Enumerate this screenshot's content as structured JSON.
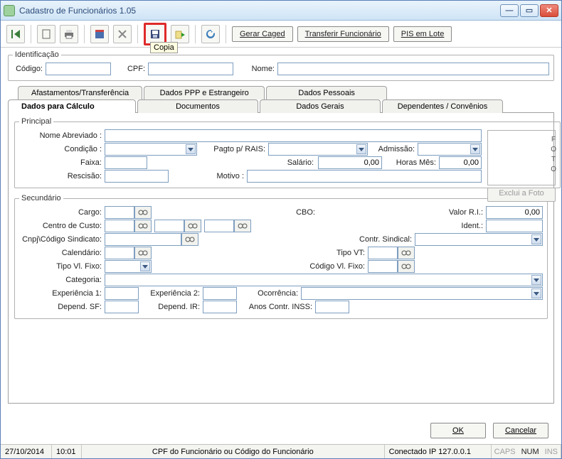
{
  "window": {
    "title": "Cadastro de Funcionários 1.05"
  },
  "toolbar": {
    "tooltip_copia": "Copia",
    "gerar_caged": "Gerar Caged",
    "transf_func": "Transferir Funcionário",
    "pis_lote": "PIS em Lote"
  },
  "ident": {
    "legend": "Identificação",
    "codigo_label": "Código:",
    "codigo_value": "",
    "cpf_label": "CPF:",
    "cpf_value": "",
    "nome_label": "Nome:",
    "nome_value": ""
  },
  "tabs_row1": {
    "afast": "Afastamentos/Transferência",
    "ppp": "Dados PPP e Estrangeiro",
    "pessoais": "Dados Pessoais"
  },
  "tabs_row2": {
    "calculo": "Dados para Cálculo",
    "documentos": "Documentos",
    "gerais": "Dados Gerais",
    "dependentes": "Dependentes / Convênios"
  },
  "principal": {
    "legend": "Principal",
    "nome_abrev_label": "Nome Abreviado :",
    "condicao_label": "Condição :",
    "pagto_rais_label": "Pagto p/ RAIS:",
    "admissao_label": "Admissão:",
    "faixa_label": "Faixa:",
    "salario_label": "Salário:",
    "salario_value": "0,00",
    "horas_mes_label": "Horas Mês:",
    "horas_mes_value": "0,00",
    "rescisao_label": "Rescisão:",
    "motivo_label": "Motivo :",
    "foto_label": "FOTO",
    "exclui_foto": "Exclui a Foto"
  },
  "secundario": {
    "legend": "Secundário",
    "cargo_label": "Cargo:",
    "cbo_label": "CBO:",
    "valor_ri_label": "Valor R.I.:",
    "valor_ri_value": "0,00",
    "centro_custo_label": "Centro de Custo:",
    "ident_label": "Ident.:",
    "cnpj_sind_label": "Cnpj\\Código Sindicato:",
    "contr_sind_label": "Contr. Sindical:",
    "calendario_label": "Calendário:",
    "tipo_vt_label": "Tipo VT:",
    "tipo_vl_fixo_label": "Tipo Vl. Fixo:",
    "codigo_vl_fixo_label": "Código Vl. Fixo:",
    "categoria_label": "Categoria:",
    "exp1_label": "Experiência 1:",
    "exp2_label": "Experiência 2:",
    "ocorrencia_label": "Ocorrência:",
    "depsf_label": "Depend. SF:",
    "depir_label": "Depend. IR:",
    "anos_inss_label": "Anos Contr. INSS:"
  },
  "dialog": {
    "ok": "OK",
    "cancel": "Cancelar"
  },
  "status": {
    "date": "27/10/2014",
    "time": "10:01",
    "hint": "CPF do Funcionário ou Código do Funcionário",
    "conn": "Conectado IP 127.0.0.1",
    "caps": "CAPS",
    "num": "NUM",
    "ins": "INS"
  }
}
